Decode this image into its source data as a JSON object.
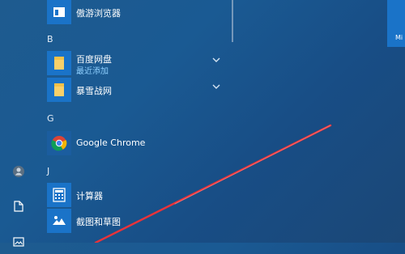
{
  "sections": [
    {
      "letter": "B"
    },
    {
      "letter": "G"
    },
    {
      "letter": "J"
    }
  ],
  "apps": {
    "aoyou": {
      "label": "傲游浏览器",
      "icon": "browser-window-icon"
    },
    "baidu": {
      "label": "百度网盘",
      "sub": "最近添加",
      "icon": "folder-icon"
    },
    "blizzard": {
      "label": "暴雪战网",
      "icon": "folder-icon"
    },
    "chrome": {
      "label": "Google Chrome",
      "icon": "chrome-icon"
    },
    "calc": {
      "label": "计算器",
      "icon": "calculator-icon"
    },
    "snip": {
      "label": "截图和草图",
      "icon": "snip-sketch-icon"
    }
  },
  "right_tile": {
    "label": "Mi"
  },
  "rail": {
    "icons": [
      "user-avatar-icon",
      "document-icon",
      "pictures-icon"
    ]
  },
  "colors": {
    "accent": "#1a73c8",
    "annotation": "#e8333a"
  }
}
